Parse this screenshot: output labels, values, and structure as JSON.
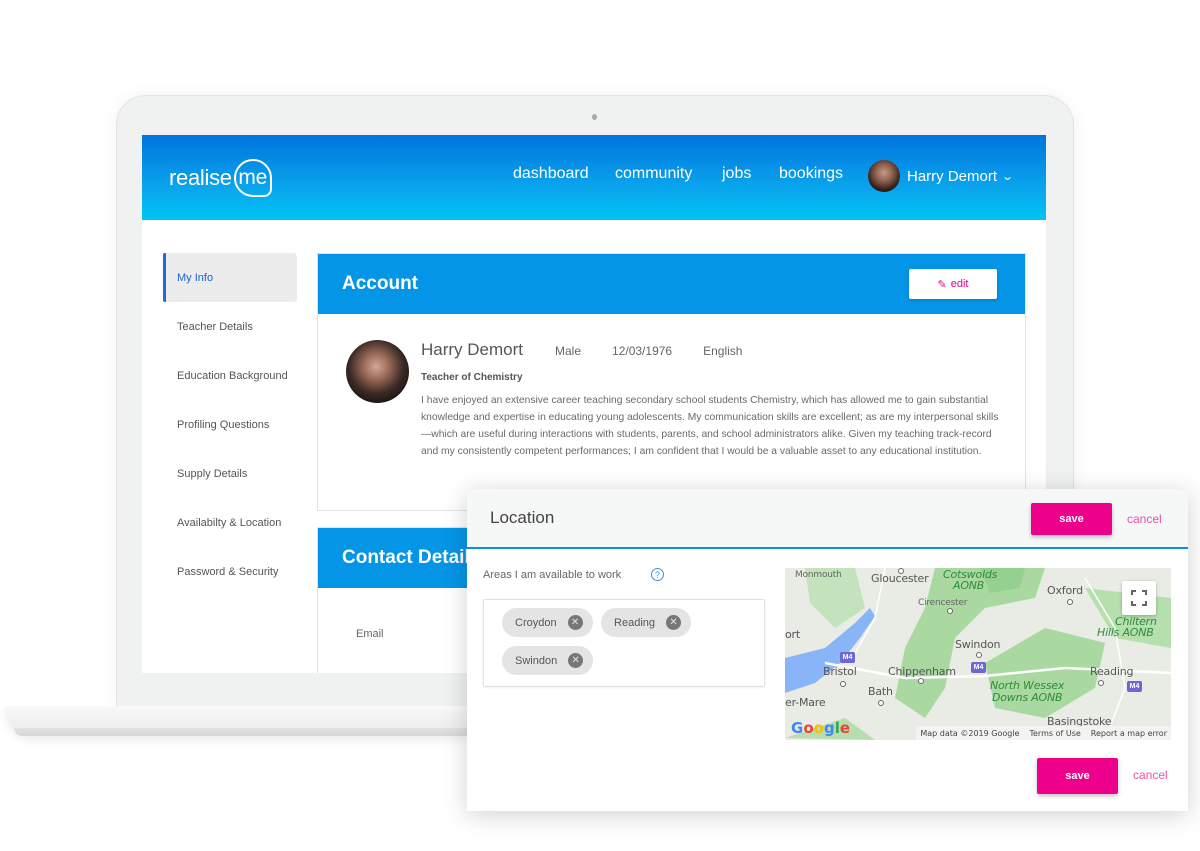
{
  "app": {
    "logo_text": "realise",
    "logo_accent": "me",
    "brand_color": "#0595e6",
    "accent_color": "#ec008c"
  },
  "nav": {
    "items": [
      {
        "label": "dashboard"
      },
      {
        "label": "community"
      },
      {
        "label": "jobs"
      },
      {
        "label": "bookings"
      }
    ],
    "user_name": "Harry Demort"
  },
  "sidebar": {
    "items": [
      {
        "label": "My Info",
        "active": true
      },
      {
        "label": "Teacher Details"
      },
      {
        "label": "Education Background"
      },
      {
        "label": "Profiling Questions"
      },
      {
        "label": "Supply Details"
      },
      {
        "label": "Availabilty & Location"
      },
      {
        "label": "Password & Security"
      }
    ]
  },
  "account": {
    "title": "Account",
    "edit_label": "edit",
    "name": "Harry Demort",
    "gender": "Male",
    "dob": "12/03/1976",
    "language": "English",
    "role": "Teacher of Chemistry",
    "bio": "I have enjoyed an extensive career teaching secondary school students Chemistry, which has allowed me to gain substantial knowledge and expertise in educating young adolescents. My communication skills are excellent; as are my interpersonal skills—which are useful during interactions with students, parents, and school administrators alike. Given my teaching track-record and my consistently competent performances; I am confident that I would be a valuable asset to any educational institution."
  },
  "contact": {
    "title": "Contact Details",
    "email_label": "Email"
  },
  "location_modal": {
    "title": "Location",
    "save_label": "save",
    "cancel_label": "cancel",
    "areas_label": "Areas I am available to work",
    "help_icon": "?",
    "tags": [
      {
        "label": "Croydon"
      },
      {
        "label": "Reading"
      },
      {
        "label": "Swindon"
      }
    ],
    "remove_icon": "✕",
    "map": {
      "labels": {
        "monmouth": "Monmouth",
        "gloucester": "Gloucester",
        "cotswolds": "Cotswolds",
        "cotswolds_aonb": "AONB",
        "cirencester": "Cirencester",
        "oxford": "Oxford",
        "chiltern": "Chiltern",
        "chiltern_aonb": "Hills AONB",
        "port": "ort",
        "swindon": "Swindon",
        "bristol": "Bristol",
        "chippenham": "Chippenham",
        "reading": "Reading",
        "bath": "Bath",
        "wessex": "North Wessex",
        "wessex_aonb": "Downs AONB",
        "super_mare": "er-Mare",
        "basingstoke": "Basingstoke"
      },
      "motorway": "M4",
      "google": "Google",
      "footer_data": "Map data ©2019 Google",
      "footer_terms": "Terms of Use",
      "footer_report": "Report a map error"
    }
  }
}
